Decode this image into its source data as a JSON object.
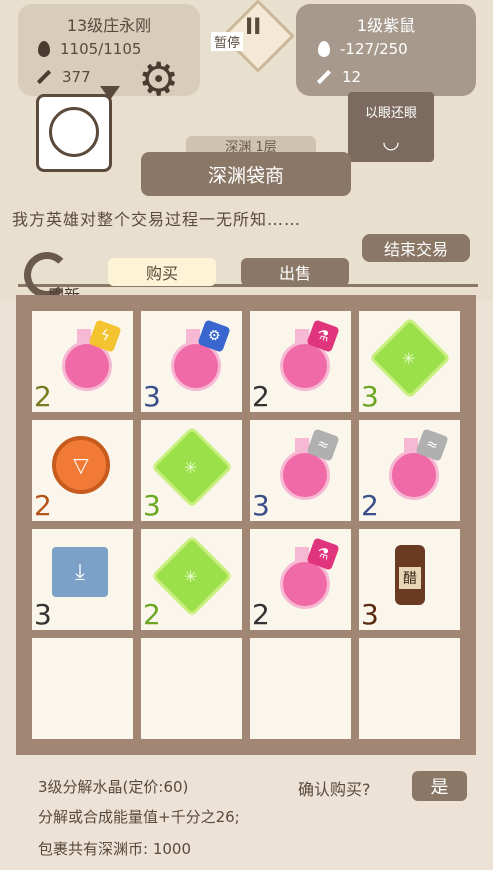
{
  "player": {
    "title": "13级庄永刚",
    "hp": "1105/1105",
    "attack": "377"
  },
  "enemy": {
    "title": "1级紫鼠",
    "hp": "-127/250",
    "attack": "12",
    "skill": "以眼还眼"
  },
  "pause": {
    "label": "暂停",
    "glyph": "II"
  },
  "depth": {
    "label": "深渊 1层"
  },
  "shop": {
    "title": "深渊袋商",
    "notice": "我方英雄对整个交易过程一无所知……",
    "end_trade": "结束交易",
    "refresh": "刷新"
  },
  "tabs": {
    "buy": "购买",
    "sell": "出售"
  },
  "grid": {
    "cells": [
      {
        "kind": "potion",
        "tag_color": "#f4c430",
        "tag_glyph": "ϟ",
        "qty": "2",
        "qty_color": "#7a7a22"
      },
      {
        "kind": "potion",
        "tag_color": "#3a66d0",
        "tag_glyph": "⚙",
        "qty": "3",
        "qty_color": "#3a4f8a"
      },
      {
        "kind": "potion",
        "tag_color": "#e0357c",
        "tag_glyph": "⚗",
        "qty": "2",
        "qty_color": "#333333"
      },
      {
        "kind": "gem",
        "qty": "3",
        "qty_color": "#6aa822"
      },
      {
        "kind": "coin",
        "qty": "2",
        "qty_color": "#b4541a"
      },
      {
        "kind": "gem",
        "qty": "3",
        "qty_color": "#6aa822"
      },
      {
        "kind": "potion",
        "tag_color": "#b0b0b0",
        "tag_glyph": "≈",
        "qty": "3",
        "qty_color": "#3a4f8a"
      },
      {
        "kind": "potion",
        "tag_color": "#b0b0b0",
        "tag_glyph": "≈",
        "qty": "2",
        "qty_color": "#3a4f8a"
      },
      {
        "kind": "scroll",
        "qty": "3",
        "qty_color": "#333333"
      },
      {
        "kind": "gem",
        "qty": "2",
        "qty_color": "#6aa822"
      },
      {
        "kind": "potion",
        "tag_color": "#e0357c",
        "tag_glyph": "⚗",
        "qty": "2",
        "qty_color": "#333333"
      },
      {
        "kind": "vinegar",
        "label": "醋",
        "qty": "3",
        "qty_color": "#5a2a10"
      },
      {
        "kind": "empty",
        "qty": ""
      },
      {
        "kind": "empty",
        "qty": ""
      },
      {
        "kind": "empty",
        "qty": ""
      },
      {
        "kind": "empty",
        "qty": ""
      }
    ]
  },
  "footer": {
    "item_name": "3级分解水晶(定价:60)",
    "confirm": "确认购买?",
    "yes": "是",
    "description": "分解或合成能量值+千分之26;",
    "abyss_coins": "包裹共有深渊币: 1000"
  }
}
